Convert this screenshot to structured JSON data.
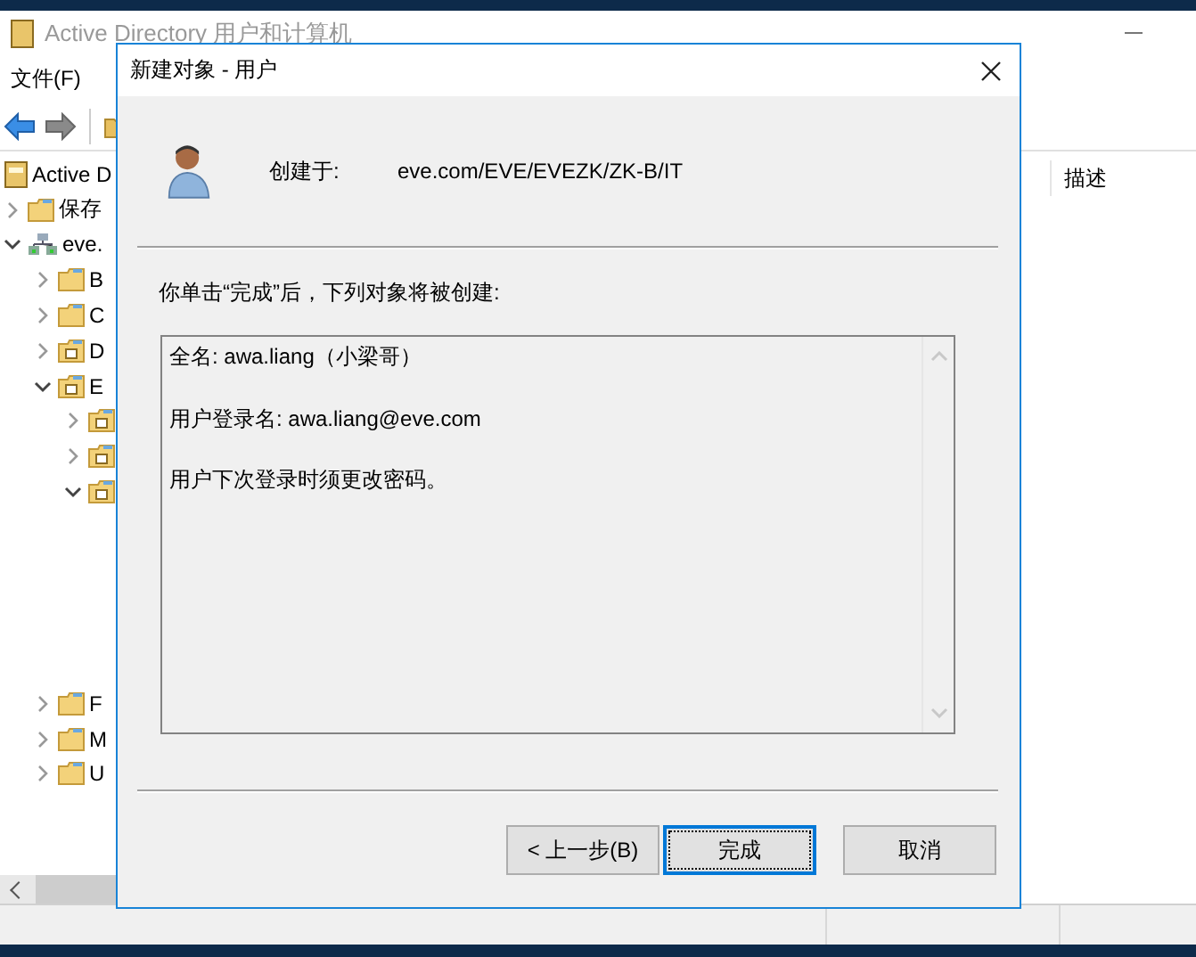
{
  "main_window": {
    "title": "Active Directory 用户和计算机",
    "menu": [
      "文件(F)"
    ],
    "tree": [
      {
        "label": "Active D",
        "kind": "root"
      },
      {
        "label": "保存",
        "kind": "folder",
        "expanded": false
      },
      {
        "label": "eve.",
        "kind": "domain",
        "expanded": true,
        "children": [
          {
            "label": "B",
            "kind": "folder",
            "expanded": false
          },
          {
            "label": "C",
            "kind": "folder",
            "expanded": false
          },
          {
            "label": "D",
            "kind": "ou",
            "expanded": false
          },
          {
            "label": "E",
            "kind": "ou",
            "expanded": true,
            "children": [
              {
                "kind": "ou",
                "expanded": false
              },
              {
                "kind": "ou",
                "expanded": false
              },
              {
                "kind": "ou",
                "expanded": true
              }
            ]
          },
          {
            "label": "F",
            "kind": "folder",
            "expanded": false
          },
          {
            "label": "M",
            "kind": "folder",
            "expanded": false
          },
          {
            "label": "U",
            "kind": "folder",
            "expanded": false
          }
        ]
      }
    ],
    "columns": [
      "描述"
    ]
  },
  "dialog": {
    "title": "新建对象 - 用户",
    "created_in_label": "创建于:",
    "created_in_path": "eve.com/EVE/EVEZK/ZK-B/IT",
    "intro": "你单击“完成”后，下列对象将被创建:",
    "summary": [
      "全名: awa.liang（小梁哥）",
      "用户登录名: awa.liang@eve.com",
      "用户下次登录时须更改密码。"
    ],
    "buttons": [
      {
        "label": "< 上一步(B)",
        "selected": false
      },
      {
        "label": "完成",
        "selected": true
      },
      {
        "label": "取消",
        "selected": false
      }
    ]
  }
}
